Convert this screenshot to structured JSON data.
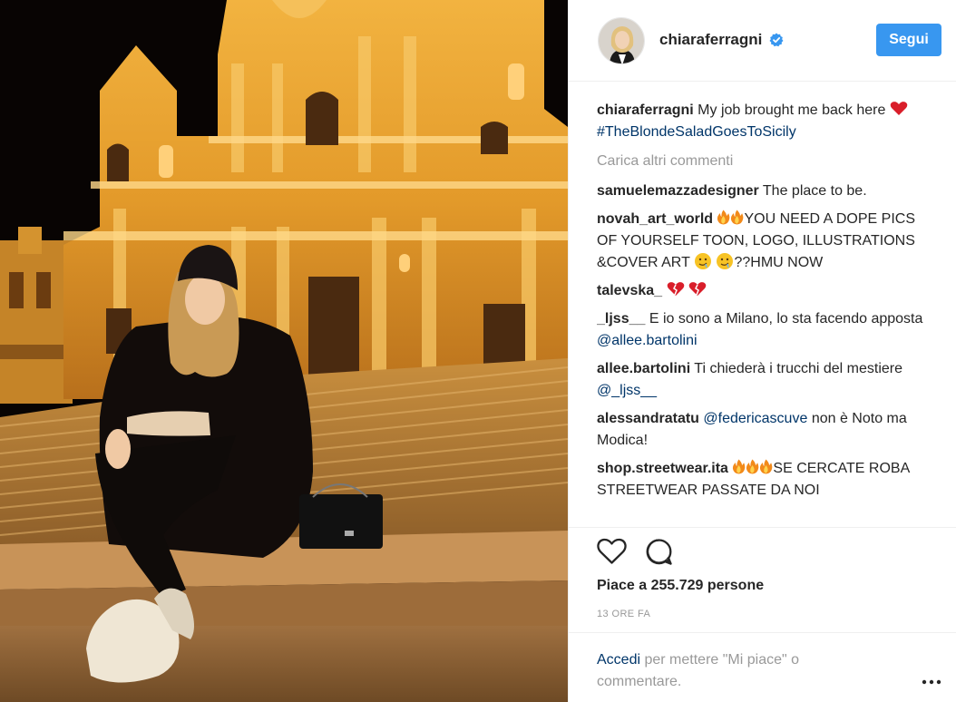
{
  "post": {
    "image_alt": "Photo",
    "username": "chiaraferragni",
    "follow_label": "Segui",
    "caption": {
      "user": "chiaraferragni",
      "text_before": "My job brought me back here",
      "hashtag": "#TheBlondeSaladGoesToSicily"
    },
    "load_more": "Carica altri commenti",
    "comments": [
      {
        "user": "samuelemazzadesigner",
        "text": "The place to be."
      },
      {
        "user": "novah_art_world",
        "text": "YOU NEED A DOPE PICS OF YOURSELF TOON, LOGO, ILLUSTRATIONS &COVER ART",
        "text_after": "??HMU NOW"
      },
      {
        "user": "talevska_"
      },
      {
        "user": "_ljss__",
        "text": "E io sono a Milano, lo sta facendo apposta",
        "mention": "@allee.bartolini"
      },
      {
        "user": "allee.bartolini",
        "text": "Ti chiederà i trucchi del mestiere",
        "mention": "@_ljss__"
      },
      {
        "user": "alessandratatu",
        "mention": "@federicascuve",
        "text": "non è Noto ma Modica!"
      },
      {
        "user": "shop.streetwear.ita",
        "text": "SE CERCATE ROBA STREETWEAR PASSATE DA NOI"
      }
    ],
    "likes_text": "Piace a 255.729 persone",
    "time_text": "13 ORE FA",
    "login_link": "Accedi",
    "login_rest": "per mettere \"Mi piace\" o commentare.",
    "icons": {
      "verified": "verified-badge-icon",
      "like": "heart-outline-icon",
      "comment": "speech-bubble-icon",
      "more": "ellipsis-icon"
    },
    "colors": {
      "accent": "#3897f0",
      "link": "#003569",
      "muted": "#999999",
      "text": "#262626"
    }
  }
}
